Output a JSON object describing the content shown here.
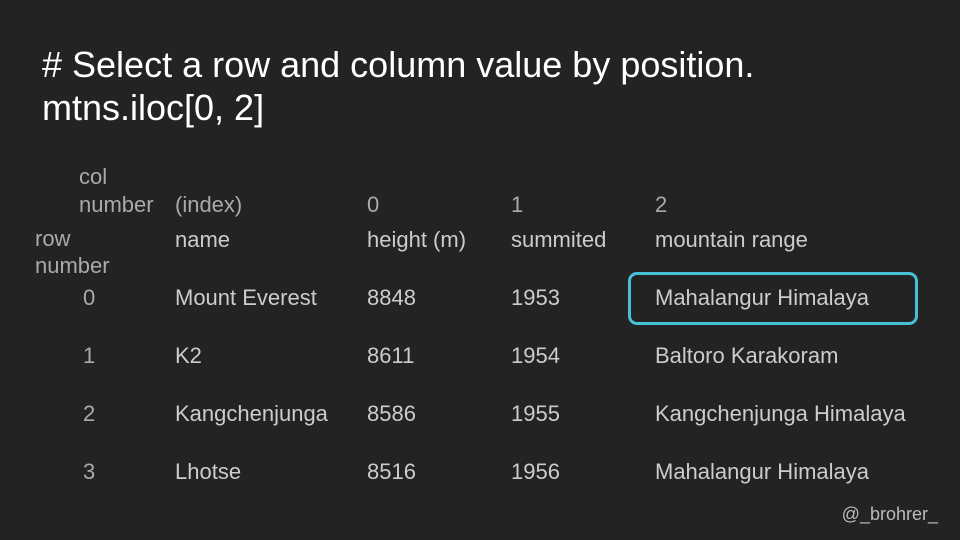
{
  "title": {
    "line1": "# Select a row and column value by position.",
    "line2": "mtns.iloc[0, 2]"
  },
  "table": {
    "col_number_label_1": "col",
    "col_number_label_2": "number",
    "row_number_label_1": "row",
    "row_number_label_2": "number",
    "col_numbers": [
      "(index)",
      "0",
      "1",
      "2"
    ],
    "col_names": [
      "name",
      "height (m)",
      "summited",
      "mountain range"
    ],
    "rows": [
      {
        "num": "0",
        "name": "Mount Everest",
        "height": "8848",
        "summited": "1953",
        "range": "Mahalangur Himalaya"
      },
      {
        "num": "1",
        "name": "K2",
        "height": "8611",
        "summited": "1954",
        "range": "Baltoro Karakoram"
      },
      {
        "num": "2",
        "name": "Kangchenjunga",
        "height": "8586",
        "summited": "1955",
        "range": "Kangchenjunga Himalaya"
      },
      {
        "num": "3",
        "name": "Lhotse",
        "height": "8516",
        "summited": "1956",
        "range": "Mahalangur Himalaya"
      }
    ],
    "highlighted_cell": {
      "row": 0,
      "col": 2
    }
  },
  "credit": "@_brohrer_",
  "colors": {
    "background": "#232323",
    "highlight": "#48c1d6",
    "title_text": "#ffffff",
    "body_text": "#cccccc"
  }
}
